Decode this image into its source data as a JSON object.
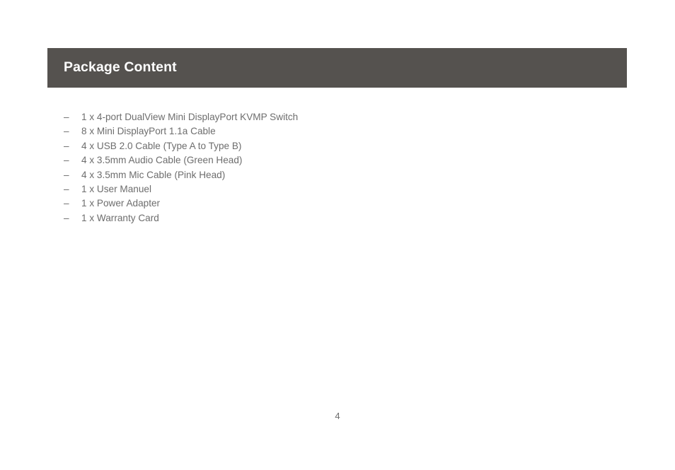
{
  "document": {
    "section": {
      "title": "Package Content",
      "bar_color": "#55524F",
      "title_color": "#FFFFFF"
    },
    "list": {
      "bullet_glyph": "–",
      "text_color": "#6D6D6D",
      "items": [
        "1 x 4-port DualView Mini DisplayPort KVMP Switch",
        "8 x Mini DisplayPort 1.1a Cable",
        "4 x USB 2.0 Cable (Type A to Type B)",
        "4 x 3.5mm Audio Cable (Green Head)",
        "4 x 3.5mm Mic Cable (Pink Head)",
        "1 x User Manuel",
        "1 x Power Adapter",
        "1 x Warranty Card"
      ]
    },
    "footer": {
      "page_number": "4"
    }
  }
}
